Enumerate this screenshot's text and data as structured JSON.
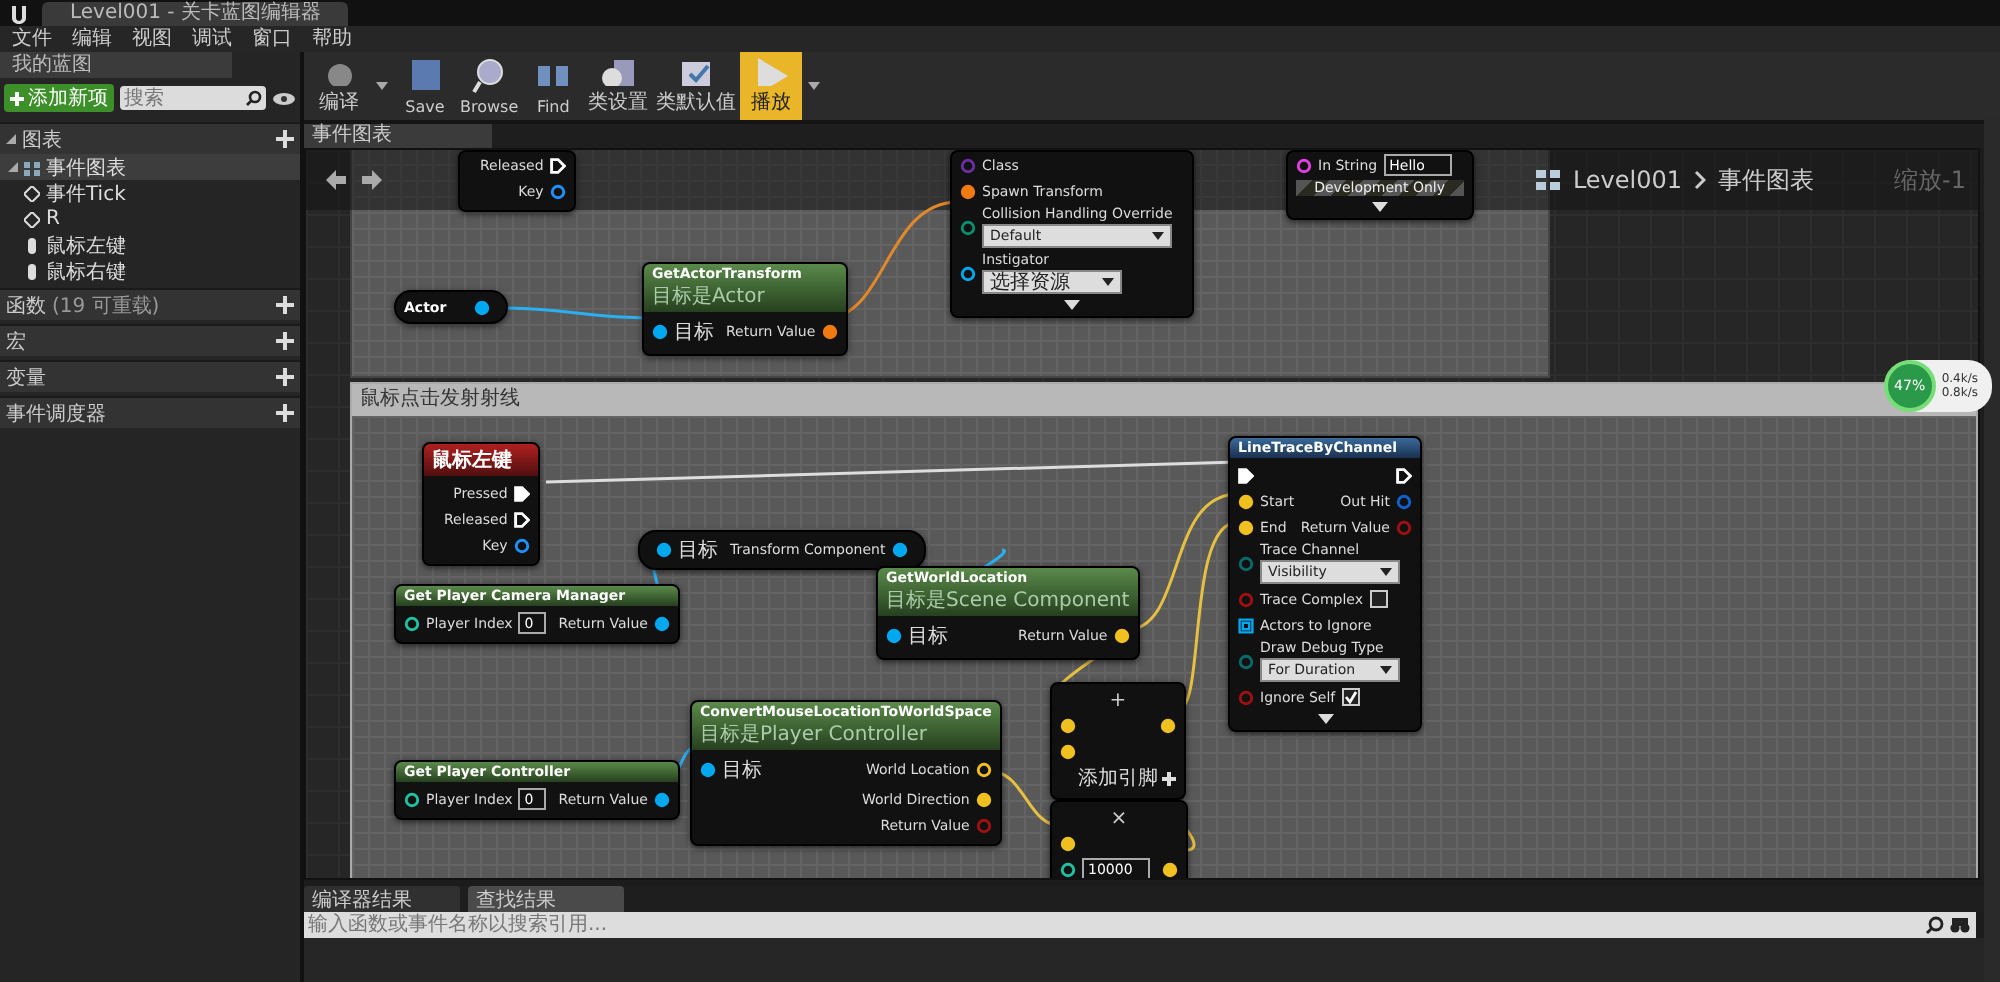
{
  "window": {
    "title": "Level001 - 关卡蓝图编辑器"
  },
  "menu": [
    "文件",
    "编辑",
    "视图",
    "调试",
    "窗口",
    "帮助"
  ],
  "sidebar": {
    "tab": "我的蓝图",
    "add_button": "添加新项",
    "search": {
      "placeholder": "搜索"
    },
    "sections": [
      {
        "label": "图表",
        "expanded": true,
        "children": [
          {
            "label": "事件图表",
            "kind": "graph",
            "selected": true,
            "expanded": true,
            "children": [
              {
                "label": "事件Tick",
                "kind": "event",
                "selected": false
              },
              {
                "label": "R",
                "kind": "key",
                "selected": false
              },
              {
                "label": "鼠标左键",
                "kind": "mouse",
                "selected": false
              },
              {
                "label": "鼠标右键",
                "kind": "mouse",
                "selected": false
              }
            ]
          }
        ]
      },
      {
        "label": "函数",
        "note": "(19 可重载)"
      },
      {
        "label": "宏"
      },
      {
        "label": "变量"
      },
      {
        "label": "事件调度器"
      }
    ]
  },
  "toolbar": [
    {
      "label": "编译",
      "kind": "compile",
      "dropdown": true,
      "selected": false
    },
    {
      "label": "Save",
      "kind": "save",
      "dropdown": false,
      "selected": false
    },
    {
      "label": "Browse",
      "kind": "browse",
      "dropdown": false,
      "selected": false
    },
    {
      "label": "Find",
      "kind": "find",
      "dropdown": false,
      "selected": false
    },
    {
      "label": "类设置",
      "kind": "settings",
      "dropdown": false,
      "selected": false
    },
    {
      "label": "类默认值",
      "kind": "defaults",
      "dropdown": false,
      "selected": false
    },
    {
      "label": "播放",
      "kind": "play",
      "dropdown": true,
      "selected": true
    }
  ],
  "graph": {
    "tab": "事件图表",
    "breadcrumb": [
      "Level001",
      "事件图表"
    ],
    "zoom": "缩放-1",
    "comments": [
      {
        "title": "鼠标点击发射射线"
      }
    ],
    "nodes": [
      {
        "kind": "fragment",
        "rows": [
          {
            "out": {
              "label": "Released",
              "kind": "exec",
              "color": "#ffffff",
              "connected": false
            }
          },
          {
            "out": {
              "label": "Key",
              "kind": "data",
              "color": "#1e90ff",
              "connected": false
            }
          }
        ]
      },
      {
        "kind": "variable",
        "title": "Actor",
        "rows": [
          {
            "out": {
              "kind": "data",
              "color": "#00a8f0",
              "connected": true
            }
          }
        ]
      },
      {
        "kind": "pure",
        "title": "GetActorTransform",
        "subtitle": "目标是Actor",
        "rows": [
          {
            "in": {
              "label": "目标",
              "kind": "data",
              "color": "#00a8f0",
              "connected": true
            },
            "out": {
              "label": "Return Value",
              "kind": "data",
              "color": "#f07a10",
              "connected": true
            }
          }
        ]
      },
      {
        "kind": "fragment",
        "advanced": true,
        "rows": [
          {
            "in": {
              "label": "Class",
              "kind": "data",
              "color": "#6a2fa0",
              "connected": false
            }
          },
          {
            "in": {
              "label": "Spawn Transform",
              "kind": "data",
              "color": "#f07a10",
              "connected": true
            }
          },
          {
            "in": {
              "label": "Collision Handling Override",
              "kind": "data",
              "color": "#0a8f6a",
              "connected": false,
              "field": {
                "kind": "select",
                "value": "Default"
              }
            }
          },
          {
            "in": {
              "label": "Instigator",
              "kind": "data",
              "color": "#00a8f0",
              "connected": false,
              "field": {
                "kind": "select",
                "value": "选择资源"
              }
            }
          }
        ]
      },
      {
        "kind": "fragment",
        "advanced": true,
        "banner": "Development Only",
        "rows": [
          {
            "in": {
              "label": "In String",
              "kind": "data",
              "color": "#e040e0",
              "connected": false,
              "field": {
                "kind": "text",
                "value": "Hello"
              }
            }
          }
        ]
      },
      {
        "kind": "event",
        "title": "鼠标左键",
        "rows": [
          {
            "out": {
              "label": "Pressed",
              "kind": "exec",
              "color": "#ffffff",
              "connected": true
            }
          },
          {
            "out": {
              "label": "Released",
              "kind": "exec",
              "color": "#ffffff",
              "connected": false
            }
          },
          {
            "out": {
              "label": "Key",
              "kind": "data",
              "color": "#1e90ff",
              "connected": false
            }
          }
        ]
      },
      {
        "kind": "pure",
        "title": "Get Player Camera Manager",
        "rows": [
          {
            "in": {
              "label": "Player Index",
              "kind": "data",
              "color": "#20c0a0",
              "connected": false,
              "field": {
                "kind": "text",
                "value": "0"
              }
            },
            "out": {
              "label": "Return Value",
              "kind": "data",
              "color": "#00a8f0",
              "connected": true
            }
          }
        ]
      },
      {
        "kind": "variable",
        "rows": [
          {
            "in": {
              "label": "目标",
              "kind": "data",
              "color": "#00a8f0",
              "connected": true
            },
            "out": {
              "label": "Transform Component",
              "kind": "data",
              "color": "#00a8f0",
              "connected": true
            }
          }
        ]
      },
      {
        "kind": "pure",
        "title": "GetWorldLocation",
        "subtitle": "目标是Scene Component",
        "rows": [
          {
            "in": {
              "label": "目标",
              "kind": "data",
              "color": "#00a8f0",
              "connected": true
            },
            "out": {
              "label": "Return Value",
              "kind": "data",
              "color": "#f0c020",
              "connected": true
            }
          }
        ]
      },
      {
        "kind": "math",
        "symbol": "+",
        "footer": "添加引脚",
        "rows": [
          {
            "in": {
              "kind": "data",
              "color": "#f0c020",
              "connected": true
            },
            "out": {
              "kind": "data",
              "color": "#f0c020",
              "connected": true
            }
          },
          {
            "in": {
              "kind": "data",
              "color": "#f0c020",
              "connected": true
            }
          }
        ]
      },
      {
        "kind": "pure",
        "title": "Get Player Controller",
        "rows": [
          {
            "in": {
              "label": "Player Index",
              "kind": "data",
              "color": "#20c0a0",
              "connected": false,
              "field": {
                "kind": "text",
                "value": "0"
              }
            },
            "out": {
              "label": "Return Value",
              "kind": "data",
              "color": "#00a8f0",
              "connected": true
            }
          }
        ]
      },
      {
        "kind": "pure",
        "title": "ConvertMouseLocationToWorldSpace",
        "subtitle": "目标是Player Controller",
        "rows": [
          {
            "in": {
              "label": "目标",
              "kind": "data",
              "color": "#00a8f0",
              "connected": true
            },
            "out": {
              "label": "World Location",
              "kind": "data",
              "color": "#f0c020",
              "connected": false
            }
          },
          {
            "out": {
              "label": "World Direction",
              "kind": "data",
              "color": "#f0c020",
              "connected": true
            }
          },
          {
            "out": {
              "label": "Return Value",
              "kind": "data",
              "color": "#a01010",
              "connected": false
            }
          }
        ]
      },
      {
        "kind": "math",
        "symbol": "×",
        "rows": [
          {
            "in": {
              "kind": "data",
              "color": "#f0c020",
              "connected": true
            }
          },
          {
            "in": {
              "kind": "data",
              "color": "#20c0a0",
              "connected": false,
              "field": {
                "kind": "text",
                "value": "10000"
              }
            },
            "out": {
              "kind": "data",
              "color": "#f0c020",
              "connected": true
            }
          }
        ]
      },
      {
        "kind": "function",
        "title": "LineTraceByChannel",
        "advanced": true,
        "rows": [
          {
            "in": {
              "kind": "exec",
              "color": "#ffffff",
              "connected": true
            },
            "out": {
              "kind": "exec",
              "color": "#ffffff",
              "connected": false
            }
          },
          {
            "in": {
              "label": "Start",
              "kind": "data",
              "color": "#f0c020",
              "connected": true
            },
            "out": {
              "label": "Out Hit",
              "kind": "data",
              "color": "#1060d0",
              "connected": false
            }
          },
          {
            "in": {
              "label": "End",
              "kind": "data",
              "color": "#f0c020",
              "connected": true
            },
            "out": {
              "label": "Return Value",
              "kind": "data",
              "color": "#a01010",
              "connected": false
            }
          },
          {
            "in": {
              "label": "Trace Channel",
              "kind": "data",
              "color": "#0a6a6a",
              "connected": false,
              "field": {
                "kind": "select",
                "value": "Visibility"
              }
            }
          },
          {
            "in": {
              "label": "Trace Complex",
              "kind": "data",
              "color": "#a01010",
              "connected": false,
              "field": {
                "kind": "checkbox",
                "checked": false
              }
            }
          },
          {
            "in": {
              "label": "Actors to Ignore",
              "kind": "array",
              "color": "#00a8f0",
              "connected": false
            }
          },
          {
            "in": {
              "label": "Draw Debug Type",
              "kind": "data",
              "color": "#0a6a6a",
              "connected": false,
              "field": {
                "kind": "select",
                "value": "For Duration"
              }
            }
          },
          {
            "in": {
              "label": "Ignore Self",
              "kind": "data",
              "color": "#a01010",
              "connected": false,
              "field": {
                "kind": "checkbox",
                "checked": true
              }
            }
          }
        ]
      }
    ]
  },
  "bottom_panel": {
    "tabs": [
      {
        "label": "编译器结果",
        "selected": false
      },
      {
        "label": "查找结果",
        "selected": true
      }
    ],
    "search": {
      "placeholder": "输入函数或事件名称以搜索引用..."
    }
  },
  "network_widget": {
    "percent": "47%",
    "upload": "0.4k/s",
    "download": "0.8k/s"
  }
}
